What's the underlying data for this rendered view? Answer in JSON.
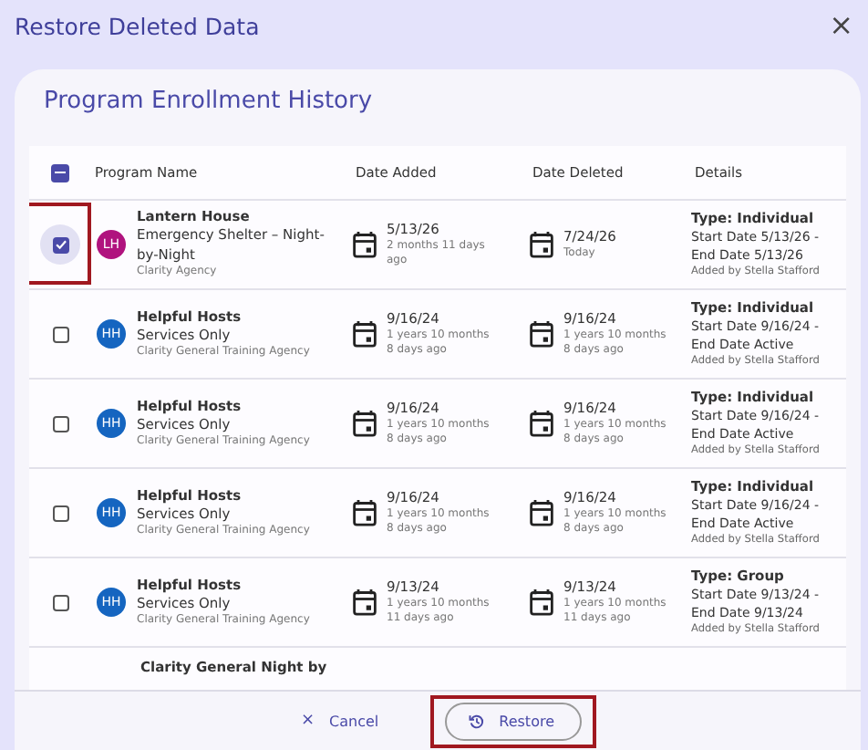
{
  "dialog": {
    "title": "Restore Deleted Data",
    "close": "×"
  },
  "section": {
    "title": "Program Enrollment History"
  },
  "table": {
    "select_all": {
      "indeterminate": true
    },
    "columns": [
      "Program Name",
      "Date Added",
      "Date Deleted",
      "Details"
    ],
    "rows": [
      {
        "checked": true,
        "highlighted": true,
        "initials": "LH",
        "color": "#b0137e",
        "name": "Lantern House",
        "program": "Emergency Shelter – Night-by-Night",
        "agency": "Clarity Agency",
        "added": "5/13/26",
        "added_ago": "2 months 11 days ago",
        "deleted": "7/24/26",
        "deleted_ago": "Today",
        "type": "Type: Individual",
        "range": "Start Date 5/13/26 - End Date 5/13/26",
        "added_by": "Added by Stella Stafford"
      },
      {
        "checked": false,
        "highlighted": false,
        "initials": "HH",
        "color": "#1565c0",
        "name": "Helpful Hosts",
        "program": "Services Only",
        "agency": "Clarity General Training Agency",
        "added": "9/16/24",
        "added_ago": "1 years 10 months 8 days ago",
        "deleted": "9/16/24",
        "deleted_ago": "1 years 10 months 8 days ago",
        "type": "Type: Individual",
        "range": "Start Date 9/16/24 - End Date Active",
        "added_by": "Added by Stella Stafford"
      },
      {
        "checked": false,
        "highlighted": false,
        "initials": "HH",
        "color": "#1565c0",
        "name": "Helpful Hosts",
        "program": "Services Only",
        "agency": "Clarity General Training Agency",
        "added": "9/16/24",
        "added_ago": "1 years 10 months 8 days ago",
        "deleted": "9/16/24",
        "deleted_ago": "1 years 10 months 8 days ago",
        "type": "Type: Individual",
        "range": "Start Date 9/16/24 - End Date Active",
        "added_by": "Added by Stella Stafford"
      },
      {
        "checked": false,
        "highlighted": false,
        "initials": "HH",
        "color": "#1565c0",
        "name": "Helpful Hosts",
        "program": "Services Only",
        "agency": "Clarity General Training Agency",
        "added": "9/16/24",
        "added_ago": "1 years 10 months 8 days ago",
        "deleted": "9/16/24",
        "deleted_ago": "1 years 10 months 8 days ago",
        "type": "Type: Individual",
        "range": "Start Date 9/16/24 - End Date Active",
        "added_by": "Added by Stella Stafford"
      },
      {
        "checked": false,
        "highlighted": false,
        "initials": "HH",
        "color": "#1565c0",
        "name": "Helpful Hosts",
        "program": "Services Only",
        "agency": "Clarity General Training Agency",
        "added": "9/13/24",
        "added_ago": "1 years 10 months 11 days ago",
        "deleted": "9/13/24",
        "deleted_ago": "1 years 10 months 11 days ago",
        "type": "Type: Group",
        "range": "Start Date 9/13/24 - End Date 9/13/24",
        "added_by": "Added by Stella Stafford"
      }
    ],
    "partial_row": {
      "name": "Clarity General Night by"
    }
  },
  "buttons": [
    {
      "kind": "cancel",
      "label": "Cancel",
      "icon": "×",
      "highlighted": false
    },
    {
      "kind": "restore",
      "label": "Restore",
      "highlighted": true
    }
  ]
}
